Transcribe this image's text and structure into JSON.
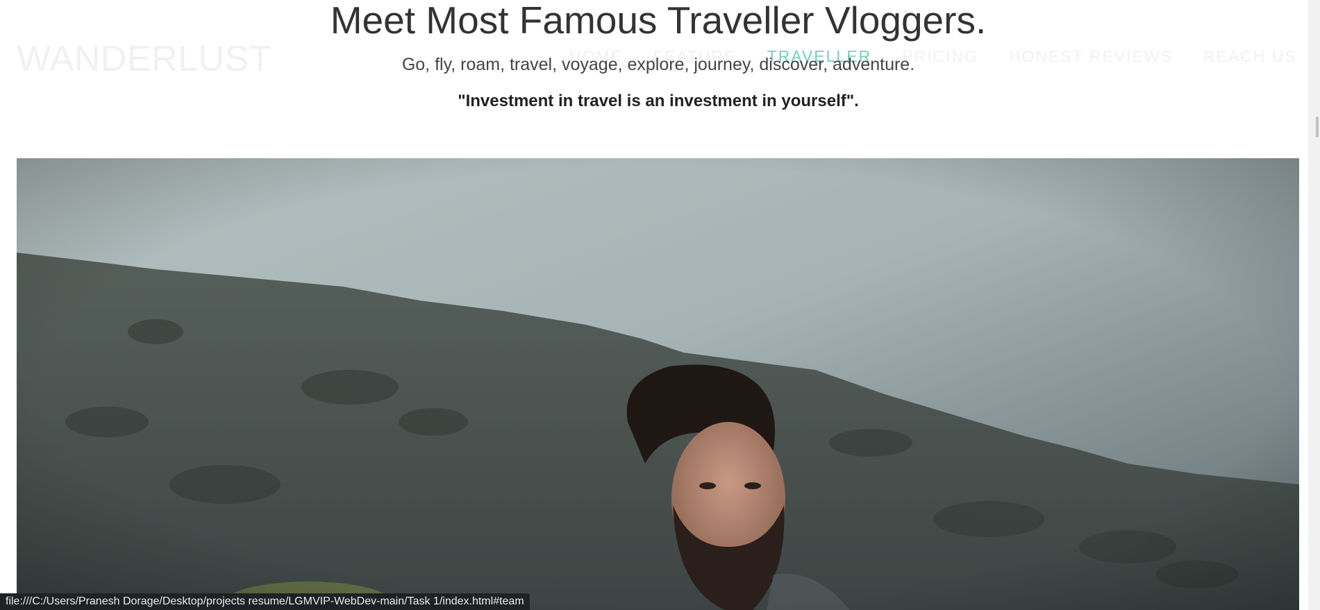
{
  "navbar": {
    "brand": "WANDERLUST",
    "links": [
      {
        "label": "HOME"
      },
      {
        "label": "FEATURE"
      },
      {
        "label": "TRAVELLER"
      },
      {
        "label": "PRICING"
      },
      {
        "label": "HONEST REVIEWS"
      },
      {
        "label": "REACH US"
      }
    ],
    "active_link": "TRAVELLER",
    "active_color": "#6fd3b7"
  },
  "section": {
    "title": "Meet Most Famous Traveller Vloggers.",
    "subtitle": "Go, fly, roam, travel, voyage, explore, journey, discover, adventure.",
    "quote": "\"Investment in travel is an investment in yourself\"."
  },
  "status_bar": {
    "url": "file:///C:/Users/Pranesh Dorage/Desktop/projects resume/LGMVIP-WebDev-main/Task 1/index.html#team"
  }
}
